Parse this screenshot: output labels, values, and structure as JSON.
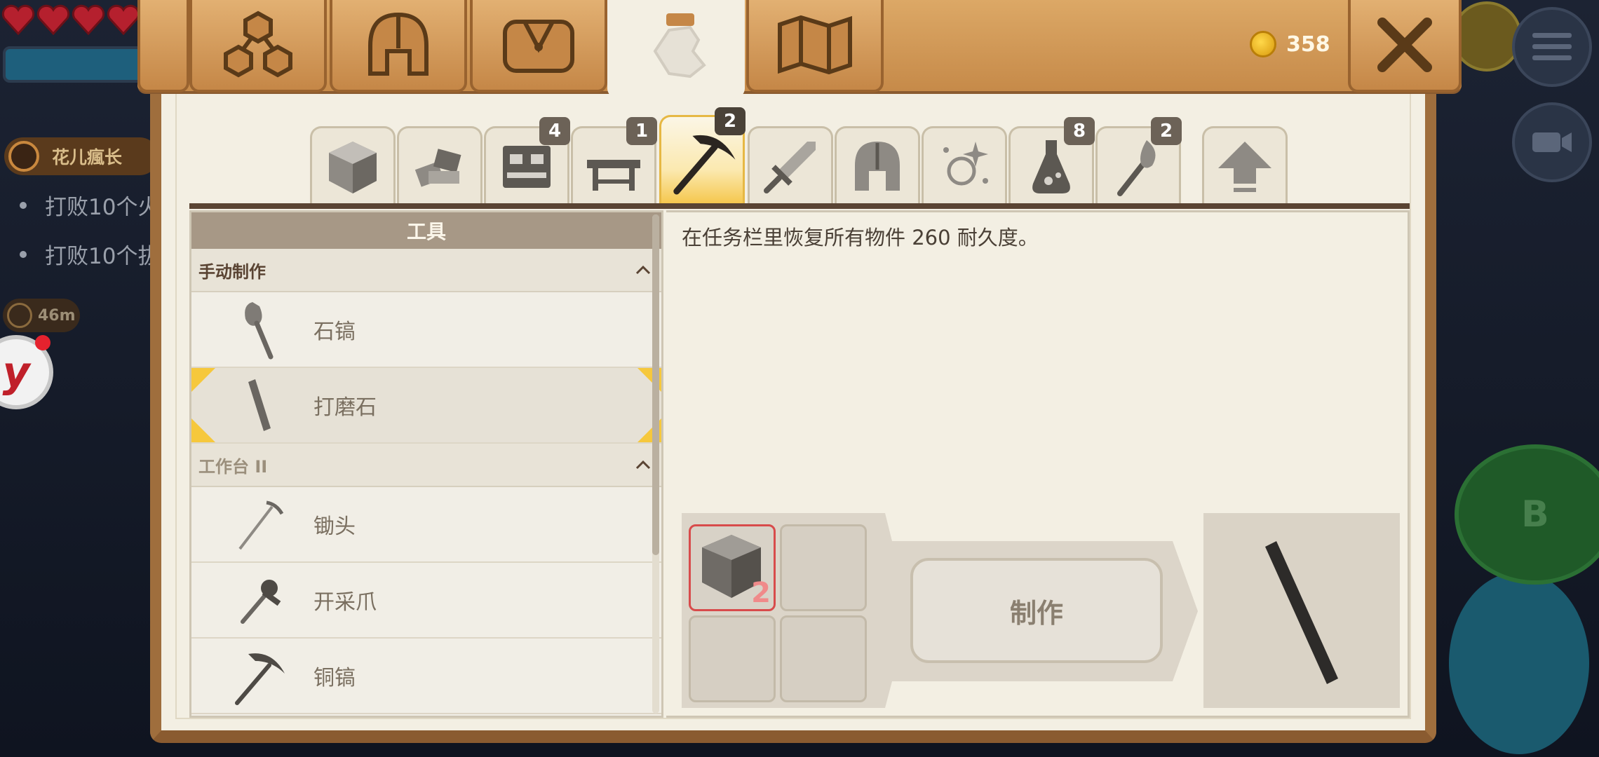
{
  "hud": {
    "quest_player": "花儿瘋长",
    "quest_lines": [
      "打败10个火",
      "打败10个拔"
    ],
    "distance": "46m",
    "b_button": "B"
  },
  "coins": "358",
  "main_tabs": [
    {
      "icon": "skill-tree-icon",
      "active": false
    },
    {
      "icon": "helmet-icon",
      "active": false
    },
    {
      "icon": "bag-icon",
      "active": false
    },
    {
      "icon": "crafting-hand-icon",
      "active": true
    },
    {
      "icon": "map-icon",
      "active": false
    }
  ],
  "categories": [
    {
      "icon": "block-icon",
      "badge": ""
    },
    {
      "icon": "bricks-icon",
      "badge": ""
    },
    {
      "icon": "workstation-icon",
      "badge": "4"
    },
    {
      "icon": "table-icon",
      "badge": "1"
    },
    {
      "icon": "pickaxe-icon",
      "badge": "2",
      "active": true
    },
    {
      "icon": "sword-icon",
      "badge": ""
    },
    {
      "icon": "helmet-icon",
      "badge": ""
    },
    {
      "icon": "sparkle-icon",
      "badge": ""
    },
    {
      "icon": "potion-icon",
      "badge": "8"
    },
    {
      "icon": "torch-icon",
      "badge": "2"
    },
    {
      "icon": "upgrade-arrow-icon",
      "badge": ""
    }
  ],
  "list": {
    "header": "工具",
    "group1": "手动制作",
    "group2": "工作台 II",
    "items": [
      {
        "label": "石镐",
        "icon": "stone-shovel-icon"
      },
      {
        "label": "打磨石",
        "icon": "whetstone-icon"
      },
      {
        "label": "锄头",
        "icon": "hoe-icon"
      },
      {
        "label": "开采爪",
        "icon": "mining-claw-icon"
      },
      {
        "label": "铜镐",
        "icon": "copper-pickaxe-icon"
      }
    ]
  },
  "detail": {
    "description": "在任务栏里恢复所有物件 260 耐久度。",
    "ingredient_qty": "2",
    "craft_label": "制作"
  }
}
